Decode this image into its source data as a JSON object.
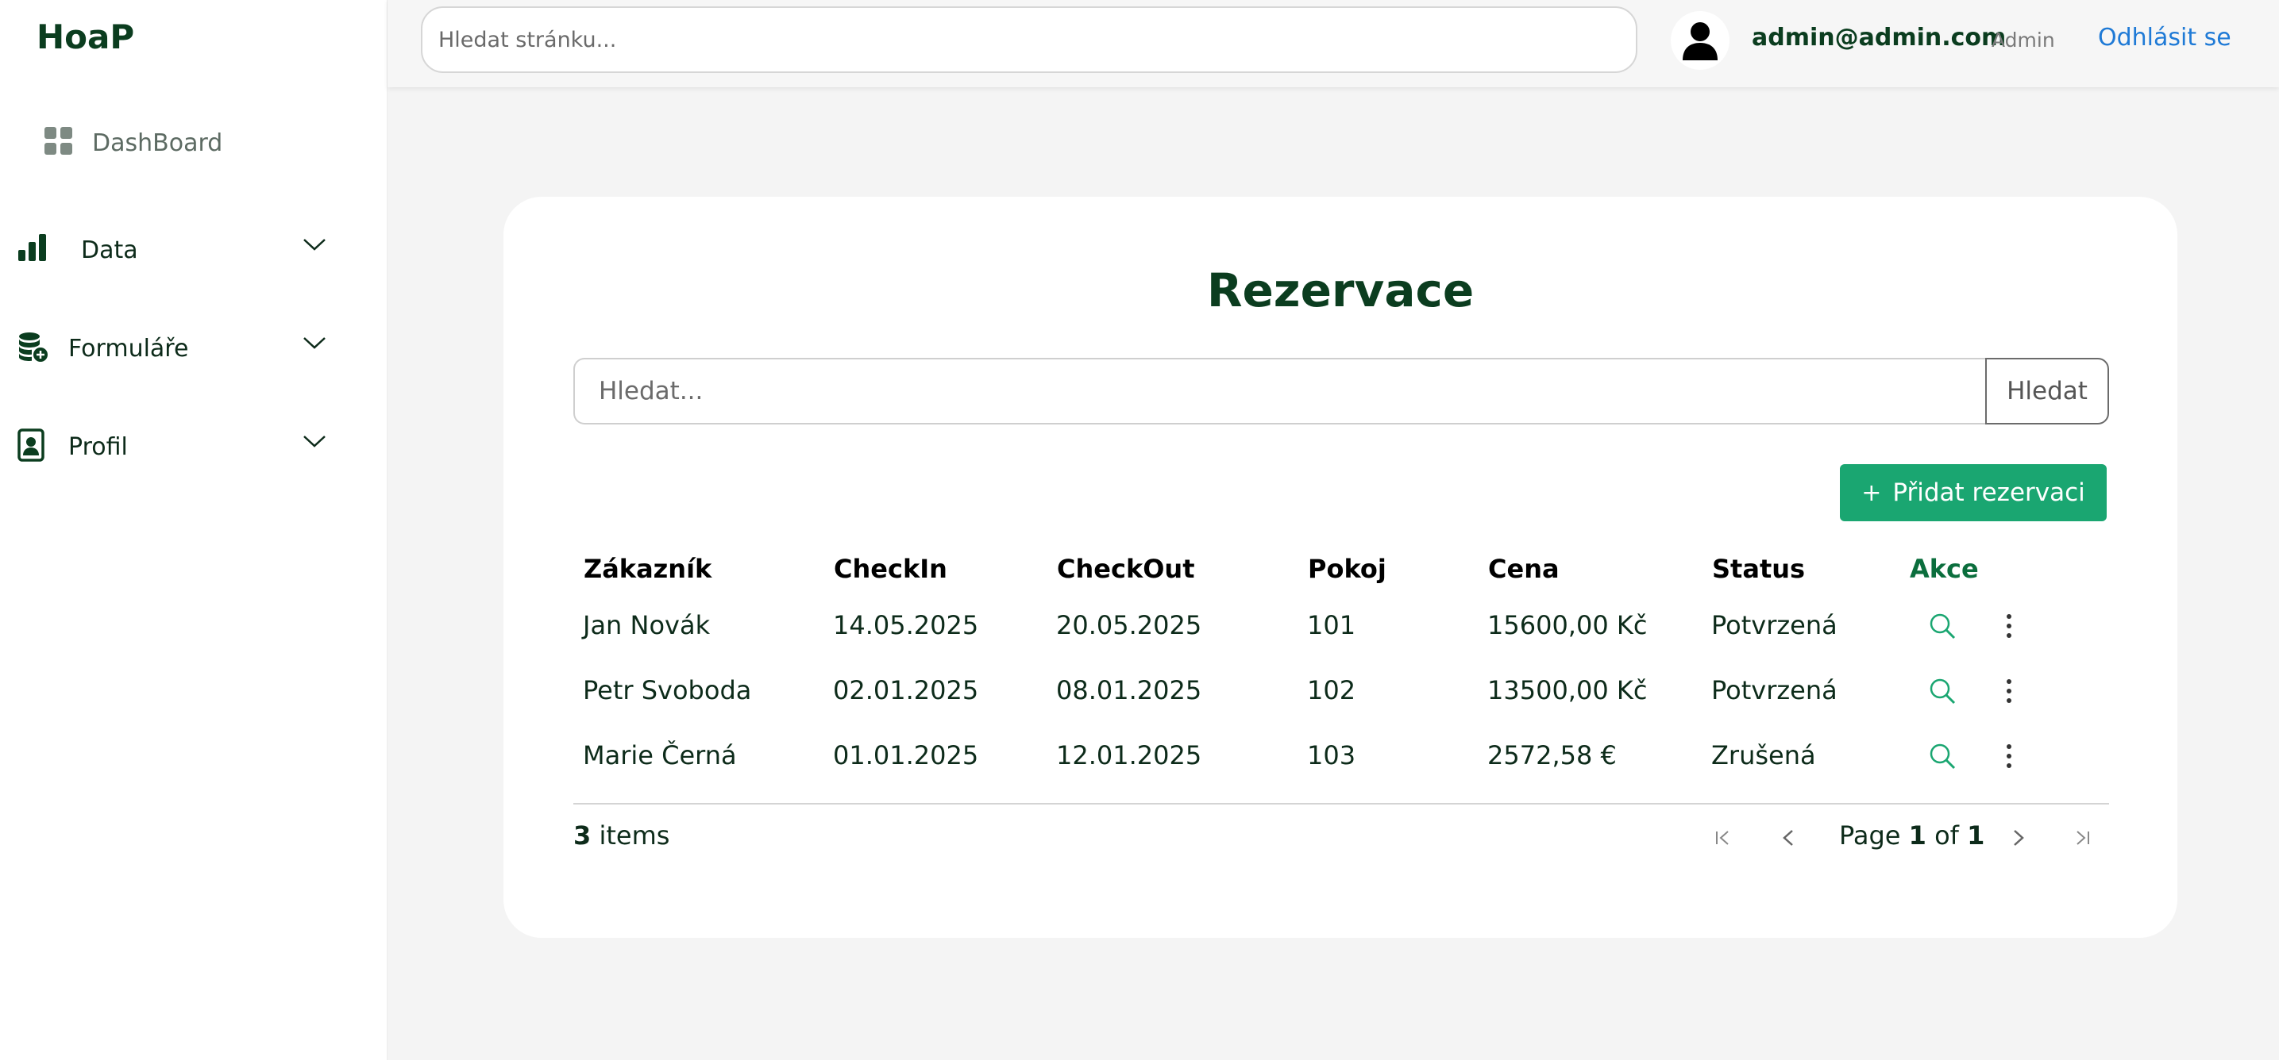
{
  "app": {
    "logo": "HoaP"
  },
  "sidebar": {
    "dashboard_label": "DashBoard",
    "items": [
      {
        "label": "Data",
        "icon": "bar-chart-icon"
      },
      {
        "label": "Formuláře",
        "icon": "database-add-icon"
      },
      {
        "label": "Profil",
        "icon": "person-badge-icon"
      }
    ]
  },
  "topbar": {
    "search_placeholder": "Hledat stránku...",
    "user_email": "admin@admin.com",
    "user_role": "Admin",
    "logout_label": "Odhlásit se"
  },
  "page": {
    "title": "Rezervace",
    "search_placeholder": "Hledat...",
    "search_button": "Hledat",
    "add_button": "Přidat rezervaci"
  },
  "table": {
    "columns": [
      "Zákazník",
      "CheckIn",
      "CheckOut",
      "Pokoj",
      "Cena",
      "Status",
      "Akce"
    ],
    "rows": [
      {
        "customer": "Jan Novák",
        "checkin": "14.05.2025",
        "checkout": "20.05.2025",
        "room": "101",
        "price": "15600,00 Kč",
        "status": "Potvrzená"
      },
      {
        "customer": "Petr Svoboda",
        "checkin": "02.01.2025",
        "checkout": "08.01.2025",
        "room": "102",
        "price": "13500,00 Kč",
        "status": "Potvrzená"
      },
      {
        "customer": "Marie Černá",
        "checkin": "01.01.2025",
        "checkout": "12.01.2025",
        "room": "103",
        "price": "2572,58 €",
        "status": "Zrušená"
      }
    ]
  },
  "pagination": {
    "items_count": "3",
    "items_label": "items",
    "page_word": "Page",
    "current_page": "1",
    "of_word": "of",
    "total_pages": "1"
  },
  "colors": {
    "brand_dark": "#0b3d1f",
    "accent_green": "#1aa671",
    "link_blue": "#1f7ad6"
  }
}
